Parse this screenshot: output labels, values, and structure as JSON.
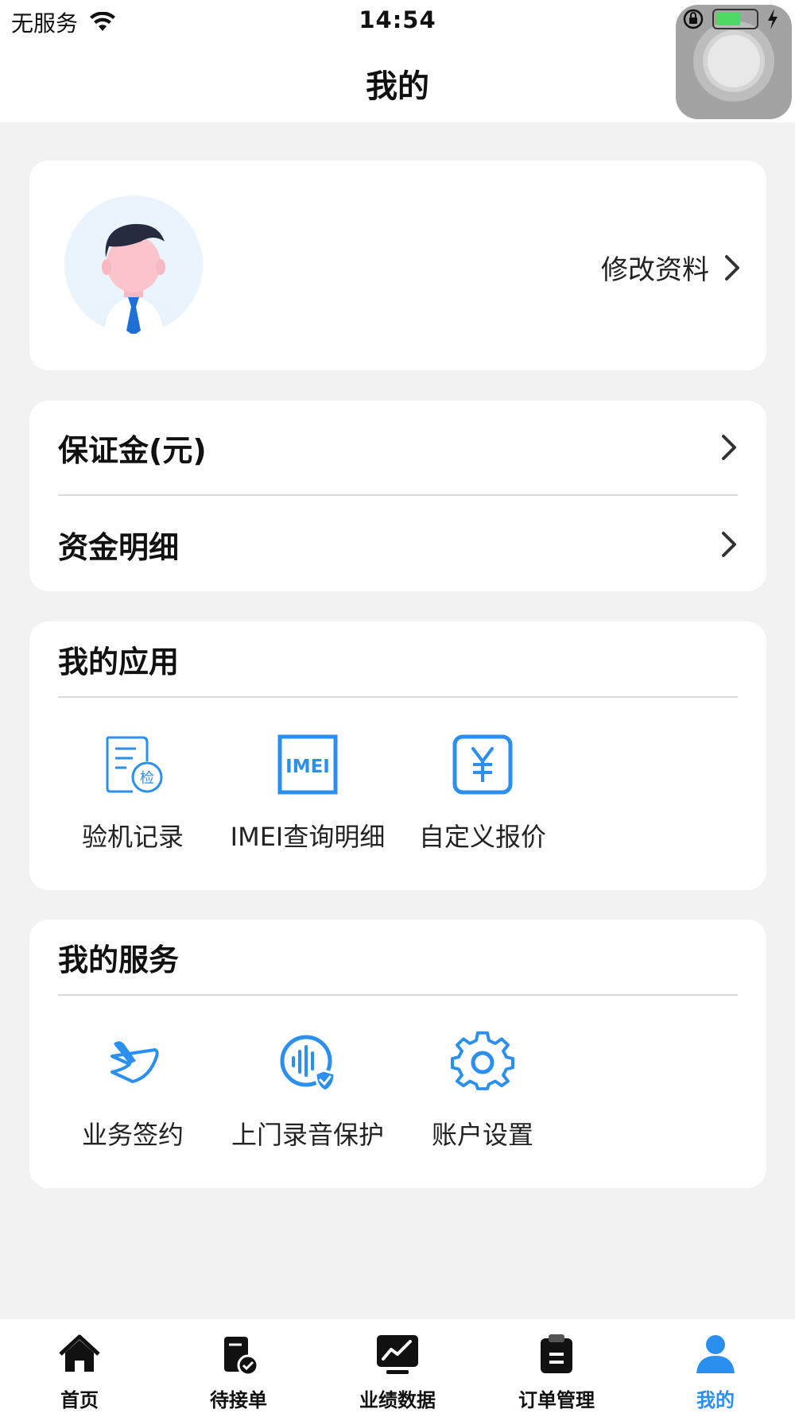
{
  "status_bar": {
    "carrier": "无服务",
    "time": "14:54"
  },
  "header": {
    "title": "我的"
  },
  "profile": {
    "edit_label": "修改资料"
  },
  "finance": {
    "items": [
      {
        "label": "保证金(元)"
      },
      {
        "label": "资金明细"
      }
    ]
  },
  "apps": {
    "title": "我的应用",
    "items": [
      {
        "label": "验机记录",
        "icon": "inspection-record-icon"
      },
      {
        "label": "IMEI查询明细",
        "icon": "imei-icon"
      },
      {
        "label": "自定义报价",
        "icon": "yuan-price-icon"
      }
    ]
  },
  "services": {
    "title": "我的服务",
    "items": [
      {
        "label": "业务签约",
        "icon": "signing-pen-icon"
      },
      {
        "label": "上门录音保护",
        "icon": "audio-protect-icon"
      },
      {
        "label": "账户设置",
        "icon": "gear-icon"
      }
    ]
  },
  "tabbar": {
    "items": [
      {
        "label": "首页",
        "icon": "home-icon"
      },
      {
        "label": "待接单",
        "icon": "pending-order-icon"
      },
      {
        "label": "业绩数据",
        "icon": "chart-icon"
      },
      {
        "label": "订单管理",
        "icon": "clipboard-icon"
      },
      {
        "label": "我的",
        "icon": "person-icon"
      }
    ],
    "active_index": 4
  },
  "colors": {
    "accent": "#2b8ff0",
    "background": "#f2f2f2",
    "card": "#ffffff"
  }
}
